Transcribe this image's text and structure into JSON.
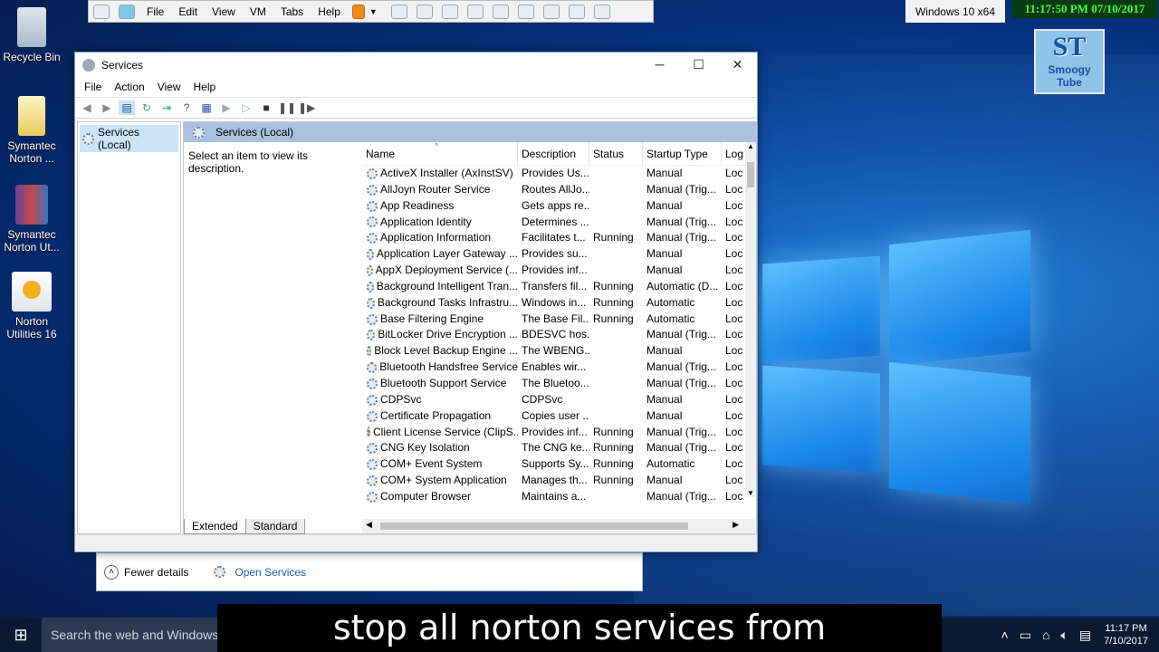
{
  "desktop": {
    "icons": [
      {
        "label": "Recycle Bin"
      },
      {
        "label": "Symantec Norton ..."
      },
      {
        "label": "Symantec Norton Ut..."
      },
      {
        "label": "Norton Utilities 16"
      }
    ]
  },
  "vm_toolbar": {
    "menus": [
      "File",
      "Edit",
      "View",
      "VM",
      "Tabs",
      "Help"
    ],
    "guest_os": "Windows 10 x64",
    "clock_overlay": "11:17:50 PM 07/10/2017"
  },
  "watermark": {
    "line1": "ST",
    "line2": "Smoogy",
    "line3": "Tube"
  },
  "services_window": {
    "title": "Services",
    "menus": [
      "File",
      "Action",
      "View",
      "Help"
    ],
    "tree_root": "Services (Local)",
    "pane_header": "Services (Local)",
    "description_hint": "Select an item to view its description.",
    "columns": [
      "Name",
      "Description",
      "Status",
      "Startup Type",
      "Log"
    ],
    "rows": [
      [
        "ActiveX Installer (AxInstSV)",
        "Provides Us...",
        "",
        "Manual",
        "Loc"
      ],
      [
        "AllJoyn Router Service",
        "Routes AllJo...",
        "",
        "Manual (Trig...",
        "Loc"
      ],
      [
        "App Readiness",
        "Gets apps re...",
        "",
        "Manual",
        "Loc"
      ],
      [
        "Application Identity",
        "Determines ...",
        "",
        "Manual (Trig...",
        "Loc"
      ],
      [
        "Application Information",
        "Facilitates t...",
        "Running",
        "Manual (Trig...",
        "Loc"
      ],
      [
        "Application Layer Gateway ...",
        "Provides su...",
        "",
        "Manual",
        "Loc"
      ],
      [
        "AppX Deployment Service (...",
        "Provides inf...",
        "",
        "Manual",
        "Loc"
      ],
      [
        "Background Intelligent Tran...",
        "Transfers fil...",
        "Running",
        "Automatic (D...",
        "Loc"
      ],
      [
        "Background Tasks Infrastru...",
        "Windows in...",
        "Running",
        "Automatic",
        "Loc"
      ],
      [
        "Base Filtering Engine",
        "The Base Fil...",
        "Running",
        "Automatic",
        "Loc"
      ],
      [
        "BitLocker Drive Encryption ...",
        "BDESVC hos...",
        "",
        "Manual (Trig...",
        "Loc"
      ],
      [
        "Block Level Backup Engine ...",
        "The WBENG...",
        "",
        "Manual",
        "Loc"
      ],
      [
        "Bluetooth Handsfree Service",
        "Enables wir...",
        "",
        "Manual (Trig...",
        "Loc"
      ],
      [
        "Bluetooth Support Service",
        "The Bluetoo...",
        "",
        "Manual (Trig...",
        "Loc"
      ],
      [
        "CDPSvc",
        "CDPSvc",
        "",
        "Manual",
        "Loc"
      ],
      [
        "Certificate Propagation",
        "Copies user ...",
        "",
        "Manual",
        "Loc"
      ],
      [
        "Client License Service (ClipS...",
        "Provides inf...",
        "Running",
        "Manual (Trig...",
        "Loc"
      ],
      [
        "CNG Key Isolation",
        "The CNG ke...",
        "Running",
        "Manual (Trig...",
        "Loc"
      ],
      [
        "COM+ Event System",
        "Supports Sy...",
        "Running",
        "Automatic",
        "Loc"
      ],
      [
        "COM+ System Application",
        "Manages th...",
        "Running",
        "Manual",
        "Loc"
      ],
      [
        "Computer Browser",
        "Maintains a...",
        "",
        "Manual (Trig...",
        "Loc"
      ]
    ],
    "tabs": [
      "Extended",
      "Standard"
    ]
  },
  "task_manager_strip": {
    "fewer_details": "Fewer details",
    "open_services": "Open Services"
  },
  "taskbar": {
    "search_placeholder": "Search the web and Windows",
    "time": "11:17 PM",
    "date": "7/10/2017"
  },
  "caption": "stop all norton services from services.msc"
}
